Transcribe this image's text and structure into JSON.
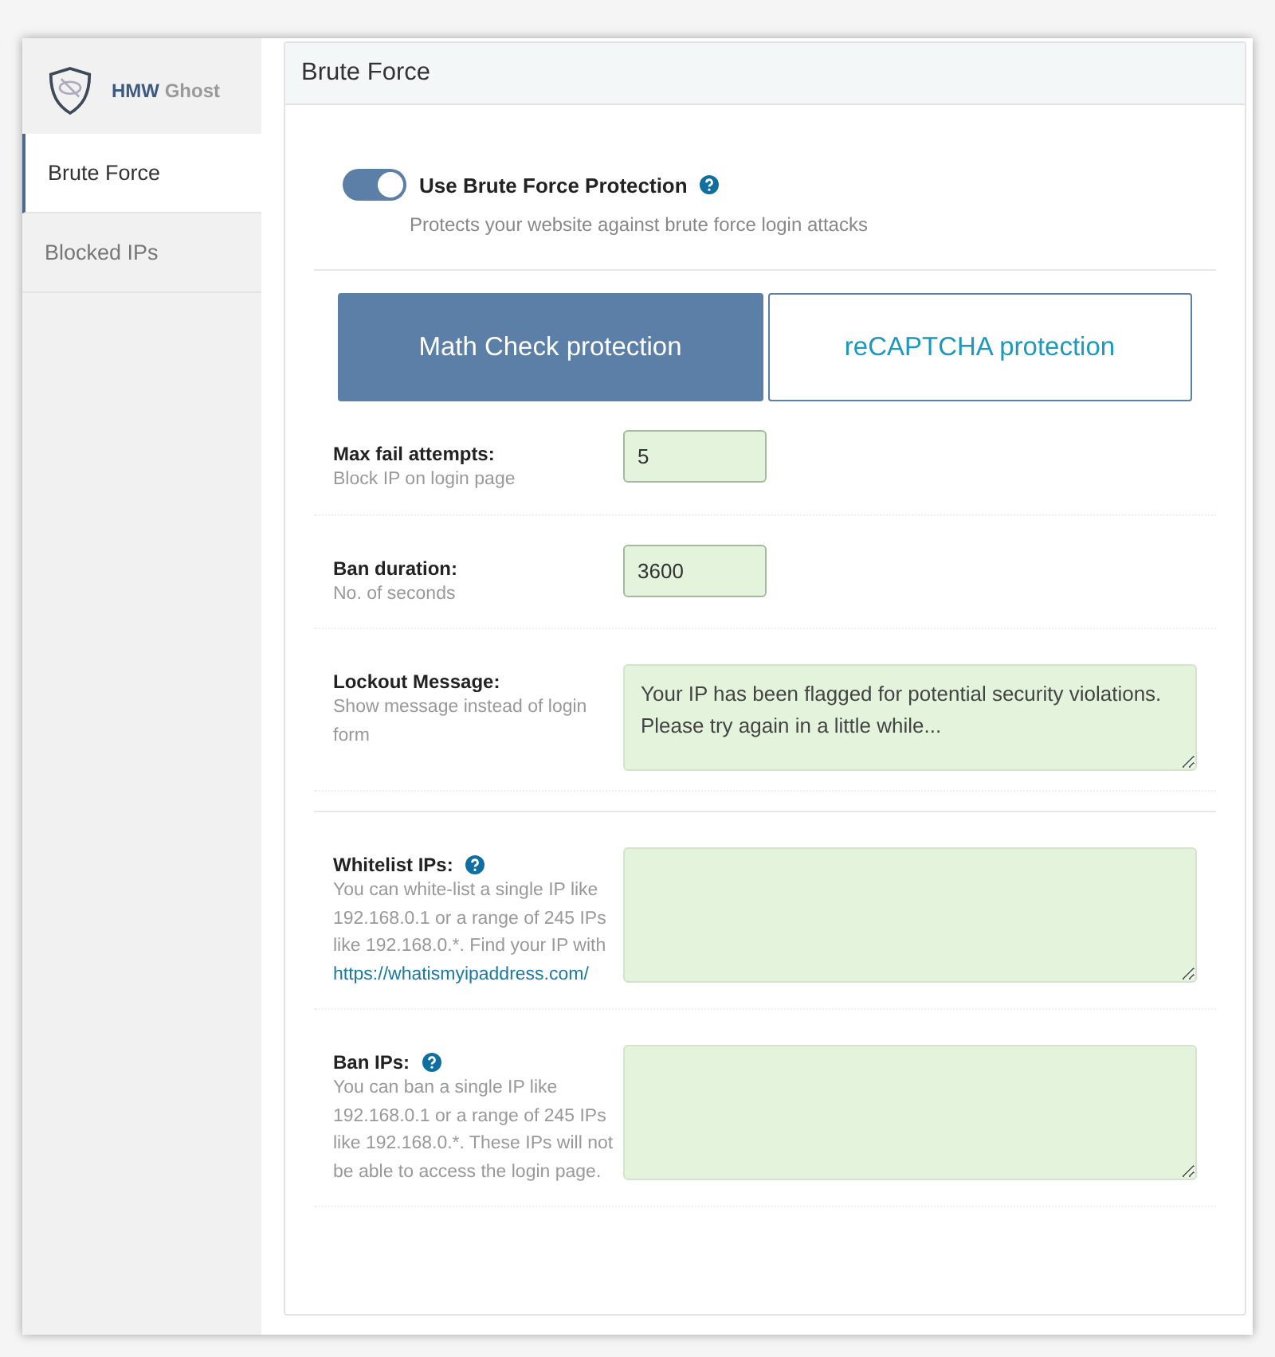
{
  "sidebar": {
    "brand": {
      "name": "HMW",
      "suffix": "Ghost"
    },
    "items": [
      {
        "label": "Brute Force",
        "selected": true
      },
      {
        "label": "Blocked IPs",
        "selected": false
      }
    ]
  },
  "panel": {
    "title": "Brute Force",
    "protection": {
      "label": "Use Brute Force Protection",
      "on": true,
      "help": true,
      "description": "Protects your website against brute force login attacks"
    },
    "methods": [
      {
        "label": "Math Check protection",
        "selected": true
      },
      {
        "label": "reCAPTCHA protection",
        "selected": false
      }
    ],
    "settings": [
      {
        "kind": "input",
        "label": "Max fail attempts:",
        "description": "Block IP on login page",
        "value": "5"
      },
      {
        "kind": "input",
        "label": "Ban duration:",
        "description": "No. of seconds",
        "value": "3600"
      },
      {
        "kind": "textarea",
        "label": "Lockout Message:",
        "description": "Show message instead of login form",
        "value": "Your IP has been flagged for potential security violations. Please try again in a little while...",
        "separator_after": true
      },
      {
        "kind": "textarea",
        "label": "Whitelist IPs:",
        "help": true,
        "description": "You can white-list a single IP like 192.168.0.1 or a range of 245 IPs like 192.168.0.*. Find your IP with",
        "link": "https://whatismyipaddress.com/"
      },
      {
        "kind": "textarea",
        "label": "Ban IPs:",
        "help": true,
        "description": "You can ban a single IP like 192.168.0.1 or a range of 245 IPs like 192.168.0.*. These IPs will not be able to access the login page."
      }
    ]
  }
}
